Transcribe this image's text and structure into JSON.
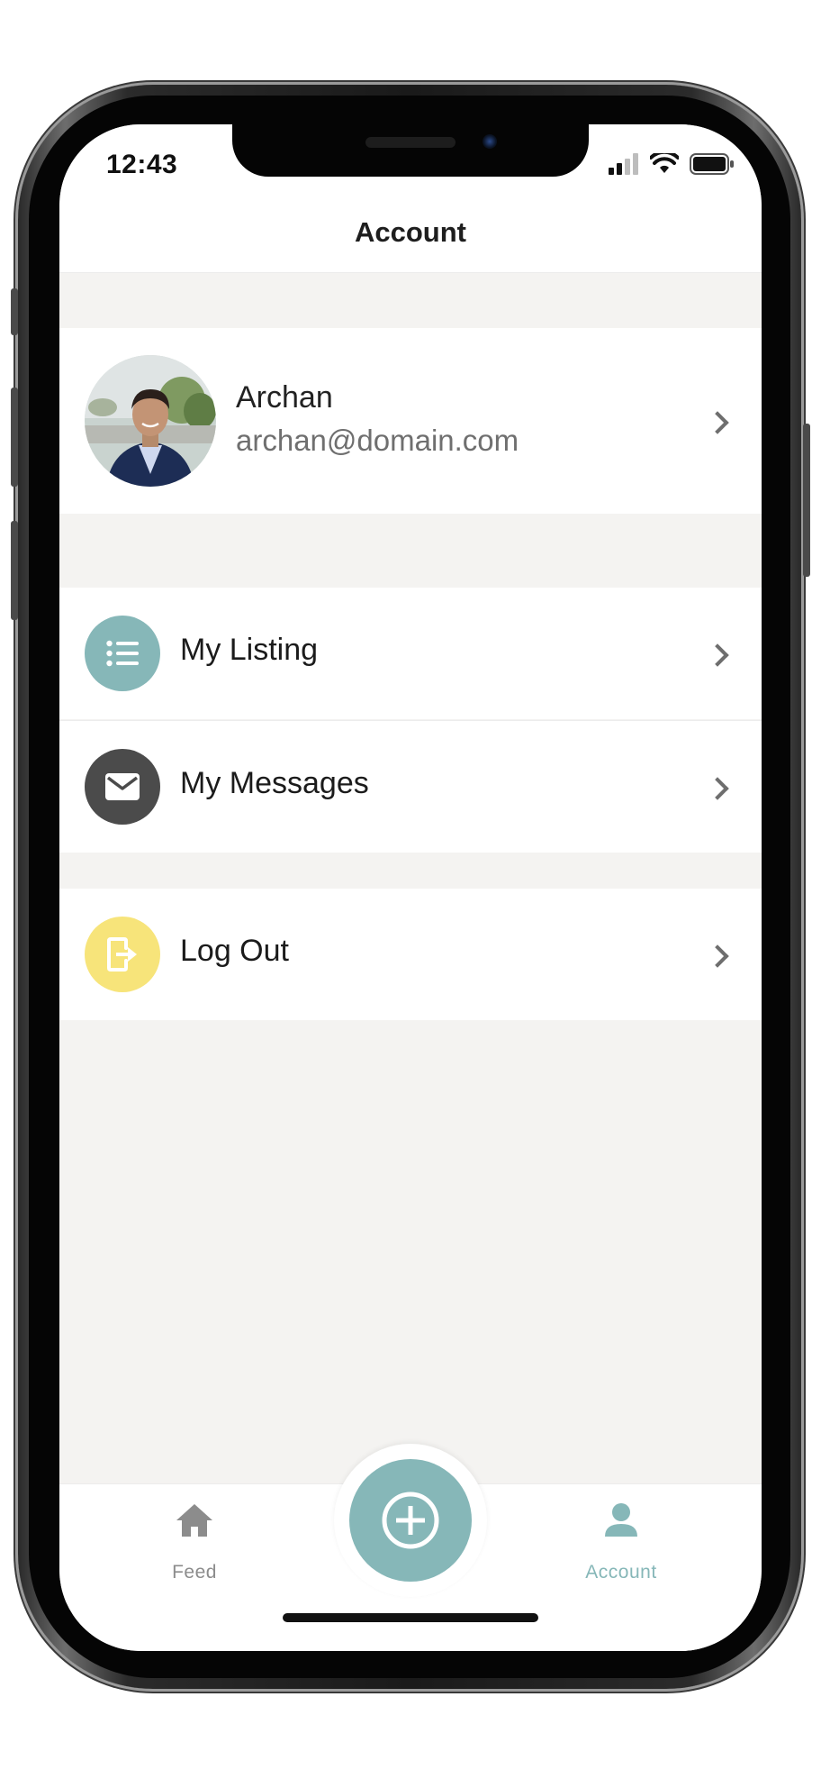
{
  "status_bar": {
    "time": "12:43",
    "icons": [
      "signal-icon",
      "wifi-icon",
      "battery-icon"
    ]
  },
  "header": {
    "title": "Account"
  },
  "profile": {
    "name": "Archan",
    "email": "archan@domain.com"
  },
  "menu": {
    "items": [
      {
        "label": "My Listing",
        "icon": "list-icon",
        "icon_bg": "#86b7b8"
      },
      {
        "label": "My Messages",
        "icon": "envelope-icon",
        "icon_bg": "#4b4b4b"
      },
      {
        "label": "Log Out",
        "icon": "logout-icon",
        "icon_bg": "#f7e47a"
      }
    ]
  },
  "tab_bar": {
    "tabs": [
      {
        "label": "Feed",
        "icon": "home-icon",
        "active": false
      },
      {
        "label": "Account",
        "icon": "user-icon",
        "active": true
      }
    ],
    "center_action": "add-icon"
  },
  "colors": {
    "accent": "#86b7b8",
    "background": "#f4f3f1",
    "inactive": "#8c8c8c"
  }
}
